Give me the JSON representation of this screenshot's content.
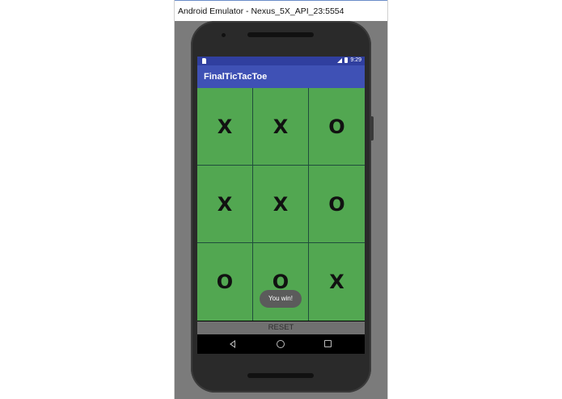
{
  "window": {
    "title": "Android Emulator - Nexus_5X_API_23:5554"
  },
  "status_bar": {
    "time": "9:29"
  },
  "app": {
    "title": "FinalTicTacToe"
  },
  "board": {
    "cells": [
      "X",
      "X",
      "O",
      "X",
      "X",
      "O",
      "O",
      "O",
      "X"
    ]
  },
  "reset_label": "RESET",
  "toast": "You win!",
  "nav": {
    "back_icon": "back-triangle-icon",
    "home_icon": "home-circle-icon",
    "recents_icon": "recents-square-icon"
  },
  "colors": {
    "cell_bg": "#52a751",
    "appbar": "#3f51b5",
    "statusbar": "#303f9f"
  }
}
